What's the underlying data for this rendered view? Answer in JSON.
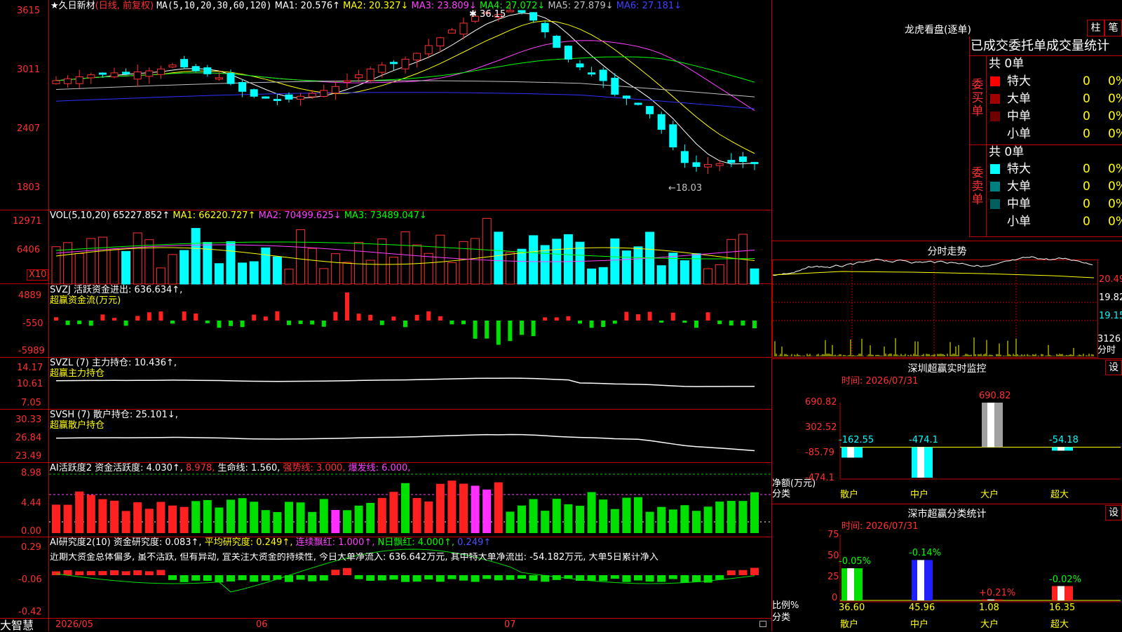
{
  "app": {
    "brand": "大智慧"
  },
  "stock": {
    "name_label": "★久日新材",
    "mode_label": "(日线, 前复权)",
    "ma_header": {
      "prefix": "MA(5,10,20,30,60,120)",
      "items": [
        {
          "text": "MA1: 20.576↑",
          "color": "#ffffff"
        },
        {
          "text": "MA2: 20.327↓",
          "color": "#ffff00"
        },
        {
          "text": "MA3: 23.809↓",
          "color": "#ff40ff"
        },
        {
          "text": "MA4: 27.072↓",
          "color": "#00ff00"
        },
        {
          "text": "MA5: 27.879↓",
          "color": "#c0c0c0"
        },
        {
          "text": "MA6: 27.181↓",
          "color": "#4040ff"
        }
      ]
    },
    "price_axis": [
      "3615",
      "3011",
      "2407",
      "1803"
    ],
    "high_label": "36.15",
    "low_label": "←18.03"
  },
  "vol": {
    "header": "VOL(5,10,20)",
    "value": "65227.852↑",
    "items": [
      {
        "text": "MA1: 66220.727↑",
        "color": "#ffff00"
      },
      {
        "text": "MA2: 70499.625↓",
        "color": "#ff40ff"
      },
      {
        "text": "MA3: 73489.047↓",
        "color": "#00ff00"
      }
    ],
    "axis": [
      "12971",
      "6406"
    ],
    "unit_badge": "X10"
  },
  "svzj": {
    "header": "SVZJ  活跃资金进出: 636.634↑,",
    "sub": "超赢资金流(万元)",
    "axis": [
      "4889",
      "-550",
      "-5989"
    ]
  },
  "svzl": {
    "header": "SVZL (7) 主力持仓: 10.436↑,",
    "sub": "超赢主力持仓",
    "axis": [
      "14.17",
      "10.61",
      "7.05"
    ]
  },
  "svsh": {
    "header": "SVSH (7) 散户持仓: 25.101↓,",
    "sub": "超赢散户持仓",
    "axis": [
      "30.33",
      "26.84",
      "23.49"
    ]
  },
  "ai_active": {
    "header": "AI活跃度2 资金活跃度: 4.030↑,",
    "v2": "8.978,",
    "life": "生命线: 1.560,",
    "strong": "强势线: 3.000,",
    "burst": "爆发线: 6.000,",
    "axis": [
      "8.98",
      "4.44",
      "0.00"
    ]
  },
  "ai_research": {
    "header": "AI研究度2(10) 资金研究度: 0.083↑,",
    "avg": "平均研究度: 0.249↑,",
    "cont": "连续飘红: 1.000↑,",
    "nday": "N日飘红: 4.000↑,",
    "last": "0.249↑",
    "comment": "近期大资金总体偏多, 虽不活跃, 但有异动, 宜关注大资金的持续性, 今日大单净流入: 636.642万元, 其中特大单净流出: -54.182万元, 大单5日累计净入",
    "axis": [
      "0.29",
      "-0.06",
      "-0.42"
    ]
  },
  "dates": [
    "2026/05",
    "06",
    "07"
  ],
  "right": {
    "longhu_title": "龙虎看盘(逐单)",
    "btn_bar": "柱",
    "btn_pen": "笔",
    "order_header": "已成交委托单成交量统计",
    "buy_label": "委买单",
    "sell_label": "委卖单",
    "buy_total": "共 0单",
    "sell_total": "共 0单",
    "buy_rows": [
      {
        "name": "特大",
        "count": "0",
        "pct": "0%",
        "color": "#ff0000"
      },
      {
        "name": "大单",
        "count": "0",
        "pct": "0%",
        "color": "#a00000"
      },
      {
        "name": "中单",
        "count": "0",
        "pct": "0%",
        "color": "#700000"
      },
      {
        "name": "小单",
        "count": "0",
        "pct": "0%",
        "color": "#000000"
      }
    ],
    "sell_rows": [
      {
        "name": "特大",
        "count": "0",
        "pct": "0%",
        "color": "#00ffff"
      },
      {
        "name": "大单",
        "count": "0",
        "pct": "0%",
        "color": "#008080"
      },
      {
        "name": "中单",
        "count": "0",
        "pct": "0%",
        "color": "#006060"
      },
      {
        "name": "小单",
        "count": "0",
        "pct": "0%",
        "color": "#000000"
      }
    ],
    "intraday_title": "分时走势",
    "intraday_axis": [
      "20.49",
      "19.82",
      "19.15",
      "3126",
      "分时"
    ],
    "monitor_title": "深圳超赢实时监控",
    "monitor_time": "时间: 2026/07/31",
    "monitor_btn": "设",
    "monitor_axis": [
      "690.82",
      "302.52",
      "-85.79",
      "-474.1"
    ],
    "monitor_ylabel": "净额(万元)",
    "monitor_xlabel": "分类",
    "stats_title": "深市超赢分类统计",
    "stats_time": "时间: 2026/07/31",
    "stats_btn": "设",
    "stats_axis": [
      "75",
      "50",
      "25",
      "0"
    ],
    "stats_ylabel": "比例%",
    "stats_xlabel": "分类"
  },
  "chart_data": [
    {
      "type": "bar",
      "title": "深圳超赢实时监控",
      "ylabel": "净额(万元)",
      "xlabel": "分类",
      "categories": [
        "散户",
        "中户",
        "大户",
        "超大"
      ],
      "values": [
        -162.55,
        -474.1,
        690.82,
        -54.18
      ],
      "value_labels": [
        "-162.55",
        "-474.1",
        "690.82",
        "-54.18"
      ],
      "ylim": [
        -474.1,
        690.82
      ]
    },
    {
      "type": "bar",
      "title": "深市超赢分类统计",
      "ylabel": "比例%",
      "xlabel": "分类",
      "categories": [
        "散户",
        "中户",
        "大户",
        "超大"
      ],
      "values": [
        36.6,
        45.96,
        1.08,
        16.35
      ],
      "value_labels": [
        "36.60",
        "45.96",
        "1.08",
        "16.35"
      ],
      "change_labels": [
        "-0.05%",
        "-0.14%",
        "+0.21%",
        "-0.02%"
      ],
      "ylim": [
        0,
        75
      ]
    }
  ]
}
